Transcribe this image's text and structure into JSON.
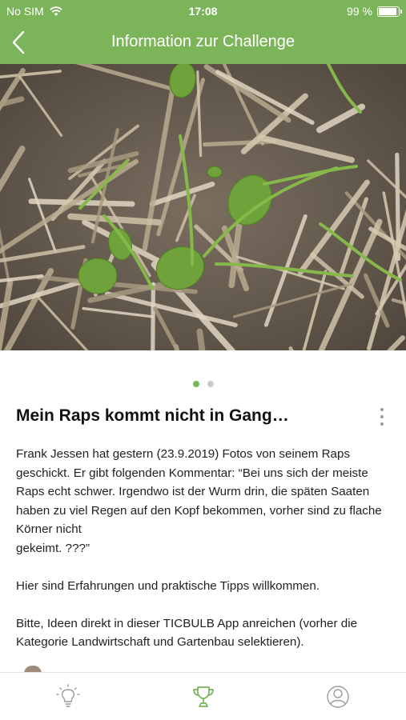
{
  "status_bar": {
    "carrier": "No SIM",
    "time": "17:08",
    "battery": "99 %",
    "battery_level": 0.99
  },
  "nav": {
    "title": "Information zur Challenge",
    "back_icon": "chevron-left-icon"
  },
  "carousel": {
    "image_desc": "photo",
    "page_count": 2,
    "active_index": 0
  },
  "post": {
    "title": "Mein Raps kommt nicht in Gang…",
    "more_icon": "more-vertical-icon",
    "paragraphs": [
      "Frank Jessen hat gestern (23.9.2019) Fotos von seinem Raps geschickt. Er gibt folgenden Kommentar: “Bei uns sich der meiste Raps echt schwer. Irgendwo ist der Wurm drin, die späten Saaten haben zu viel Regen auf den Kopf bekommen, vorher sind zu  flache Körner nicht\ngekeimt. ???”",
      "Hier sind Erfahrungen und praktische Tipps willkommen.",
      "Bitte, Ideen direkt in dieser TICBULB App anreichen (vorher die Kategorie Landwirtschaft und Gartenbau selektieren)."
    ]
  },
  "tabbar": {
    "tabs": [
      {
        "icon": "lightbulb-icon",
        "active": false
      },
      {
        "icon": "trophy-icon",
        "active": true
      },
      {
        "icon": "profile-icon",
        "active": false
      }
    ]
  },
  "colors": {
    "accent": "#7cb45a",
    "inactive_icon": "#9a9a9a"
  }
}
